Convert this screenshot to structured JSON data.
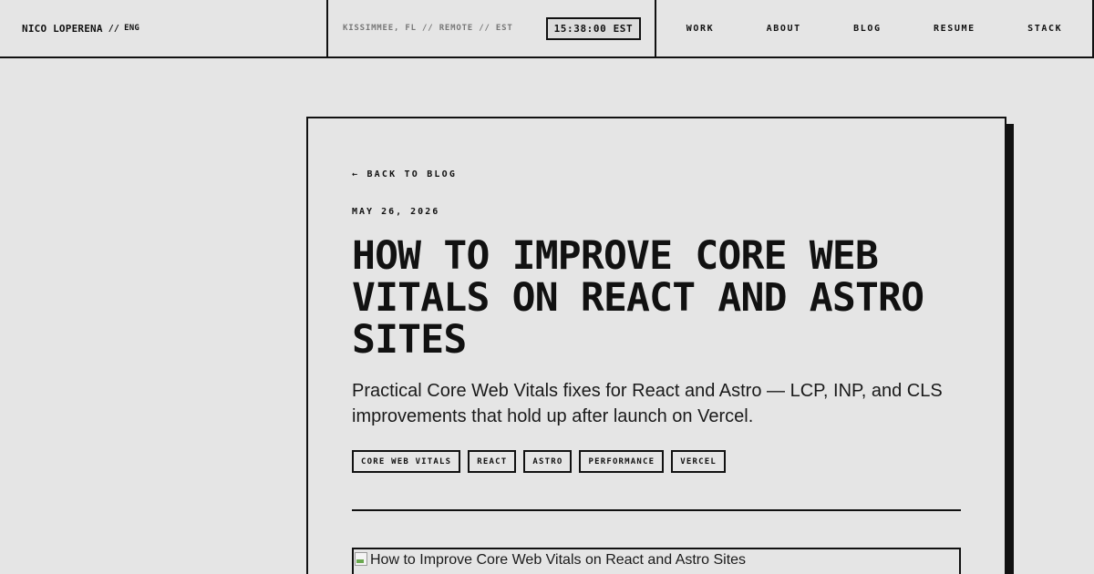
{
  "header": {
    "brand_name": "NICO LOPERENA",
    "brand_sep": "//",
    "brand_lang": "ENG",
    "location": "KISSIMMEE, FL // REMOTE // EST",
    "clock": "15:38:00 EST",
    "nav": [
      "WORK",
      "ABOUT",
      "BLOG",
      "RESUME",
      "STACK"
    ]
  },
  "article": {
    "back_link": "← BACK TO BLOG",
    "date": "MAY 26, 2026",
    "title": "How to Improve Core Web Vitals on React and Astro Sites",
    "lede": "Practical Core Web Vitals fixes for React and Astro — LCP, INP, and CLS improvements that hold up after launch on Vercel.",
    "tags": [
      "CORE WEB VITALS",
      "REACT",
      "ASTRO",
      "PERFORMANCE",
      "VERCEL"
    ],
    "hero_alt": "How to Improve Core Web Vitals on React and Astro Sites"
  },
  "colors": {
    "background": "#e5e5e5",
    "ink": "#111111",
    "muted": "#777777"
  },
  "icons": {
    "hero": "broken-image-icon"
  }
}
